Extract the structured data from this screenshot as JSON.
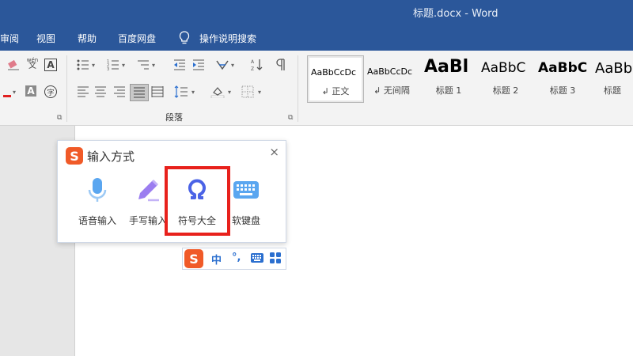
{
  "window": {
    "title": "标题.docx  -  Word"
  },
  "menu": {
    "items": [
      "审阅",
      "视图",
      "帮助",
      "百度网盘"
    ],
    "tell_me": "操作说明搜索"
  },
  "ribbon": {
    "paragraph_group_label": "段落",
    "styles": [
      {
        "sample": "AaBbCcDc",
        "name": "↲ 正文",
        "selected": true
      },
      {
        "sample": "AaBbCcDc",
        "name": "↲ 无间隔",
        "selected": false
      },
      {
        "sample": "AaBl",
        "name": "标题 1",
        "selected": false
      },
      {
        "sample": "AaBbC",
        "name": "标题 2",
        "selected": false
      },
      {
        "sample": "AaBbC",
        "name": "标题 3",
        "selected": false
      },
      {
        "sample": "AaBb",
        "name": "标题",
        "selected": false
      }
    ],
    "font_icons": {
      "phonetic": "wén",
      "phonetic_char": "文",
      "enclose_char": "字"
    }
  },
  "ime_panel": {
    "title": "输入方式",
    "logo_letter": "S",
    "options": [
      {
        "label": "语音输入",
        "icon": "microphone-icon"
      },
      {
        "label": "手写输入",
        "icon": "pencil-icon"
      },
      {
        "label": "符号大全",
        "icon": "omega-icon"
      },
      {
        "label": "软键盘",
        "icon": "keyboard-icon"
      }
    ],
    "close": "×"
  },
  "ime_toolbar": {
    "logo_letter": "S",
    "lang": "中",
    "punct": "°,",
    "keyboard_icon": "keyboard-icon",
    "grid_icon": "grid-icon"
  },
  "colors": {
    "word_blue": "#2b579a",
    "sogou_orange": "#f05a28",
    "ime_blue": "#2b6fcf",
    "highlight_red": "#e8211c"
  }
}
